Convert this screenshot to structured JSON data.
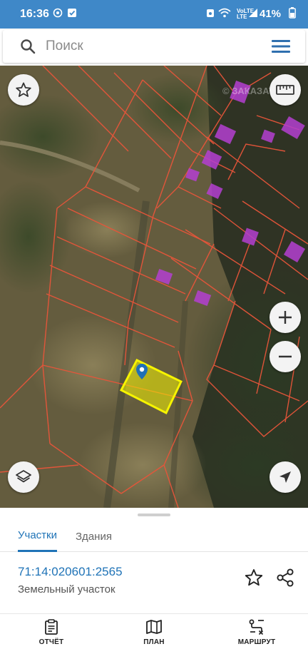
{
  "status_bar": {
    "time": "16:36",
    "battery": "41%",
    "network": "LTE",
    "volte": "VoLTE"
  },
  "search": {
    "placeholder": "Поиск",
    "value": ""
  },
  "map": {
    "watermark": "© ЗАКАЗАТЬ",
    "selected_parcel_color": "#f6f400",
    "boundary_color": "#e8553a",
    "building_color": "#b43fd1"
  },
  "sheet": {
    "tabs": [
      {
        "label": "Участки",
        "active": true
      },
      {
        "label": "Здания",
        "active": false
      }
    ],
    "parcel": {
      "number": "71:14:020601:2565",
      "type": "Земельный участок"
    }
  },
  "bottom_nav": [
    {
      "label": "ОТЧЁТ",
      "icon": "report-icon"
    },
    {
      "label": "ПЛАН",
      "icon": "map-plan-icon"
    },
    {
      "label": "МАРШРУТ",
      "icon": "route-icon"
    }
  ],
  "colors": {
    "accent": "#1f73b7",
    "status_bar": "#3f88c8"
  }
}
